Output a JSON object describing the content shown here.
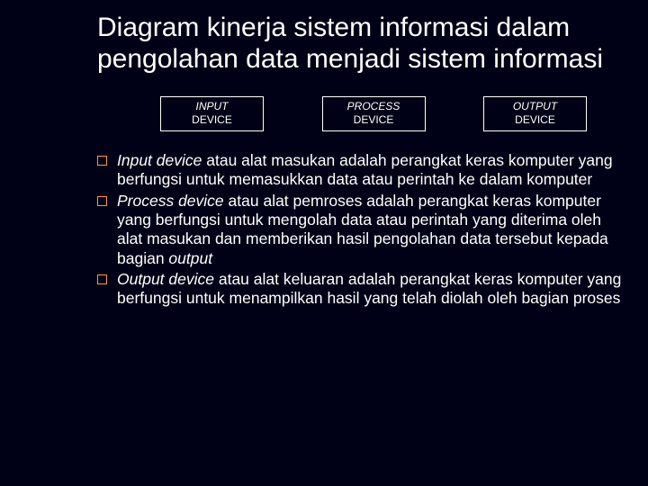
{
  "title": "Diagram kinerja sistem informasi dalam pengolahan data menjadi sistem informasi",
  "boxes": {
    "input": {
      "l1": "INPUT",
      "l2": "DEVICE"
    },
    "process": {
      "l1": "PROCESS",
      "l2": "DEVICE"
    },
    "output": {
      "l1": "OUTPUT",
      "l2": "DEVICE"
    }
  },
  "bullets": {
    "b1": {
      "term": "Input device",
      "rest": " atau alat masukan adalah perangkat keras komputer yang  berfungsi untuk memasukkan data atau perintah ke dalam komputer"
    },
    "b2": {
      "term": "Process device",
      "rest_a": " atau alat pemroses adalah perangkat keras komputer yang berfungsi untuk mengolah data atau perintah yang diterima oleh alat masukan dan memberikan hasil pengolahan data tersebut kepada bagian ",
      "rest_b": "output"
    },
    "b3": {
      "term": "Output device ",
      "rest": " atau alat keluaran adalah perangkat keras komputer yang berfungsi untuk menampilkan hasil yang telah diolah oleh bagian proses"
    }
  }
}
